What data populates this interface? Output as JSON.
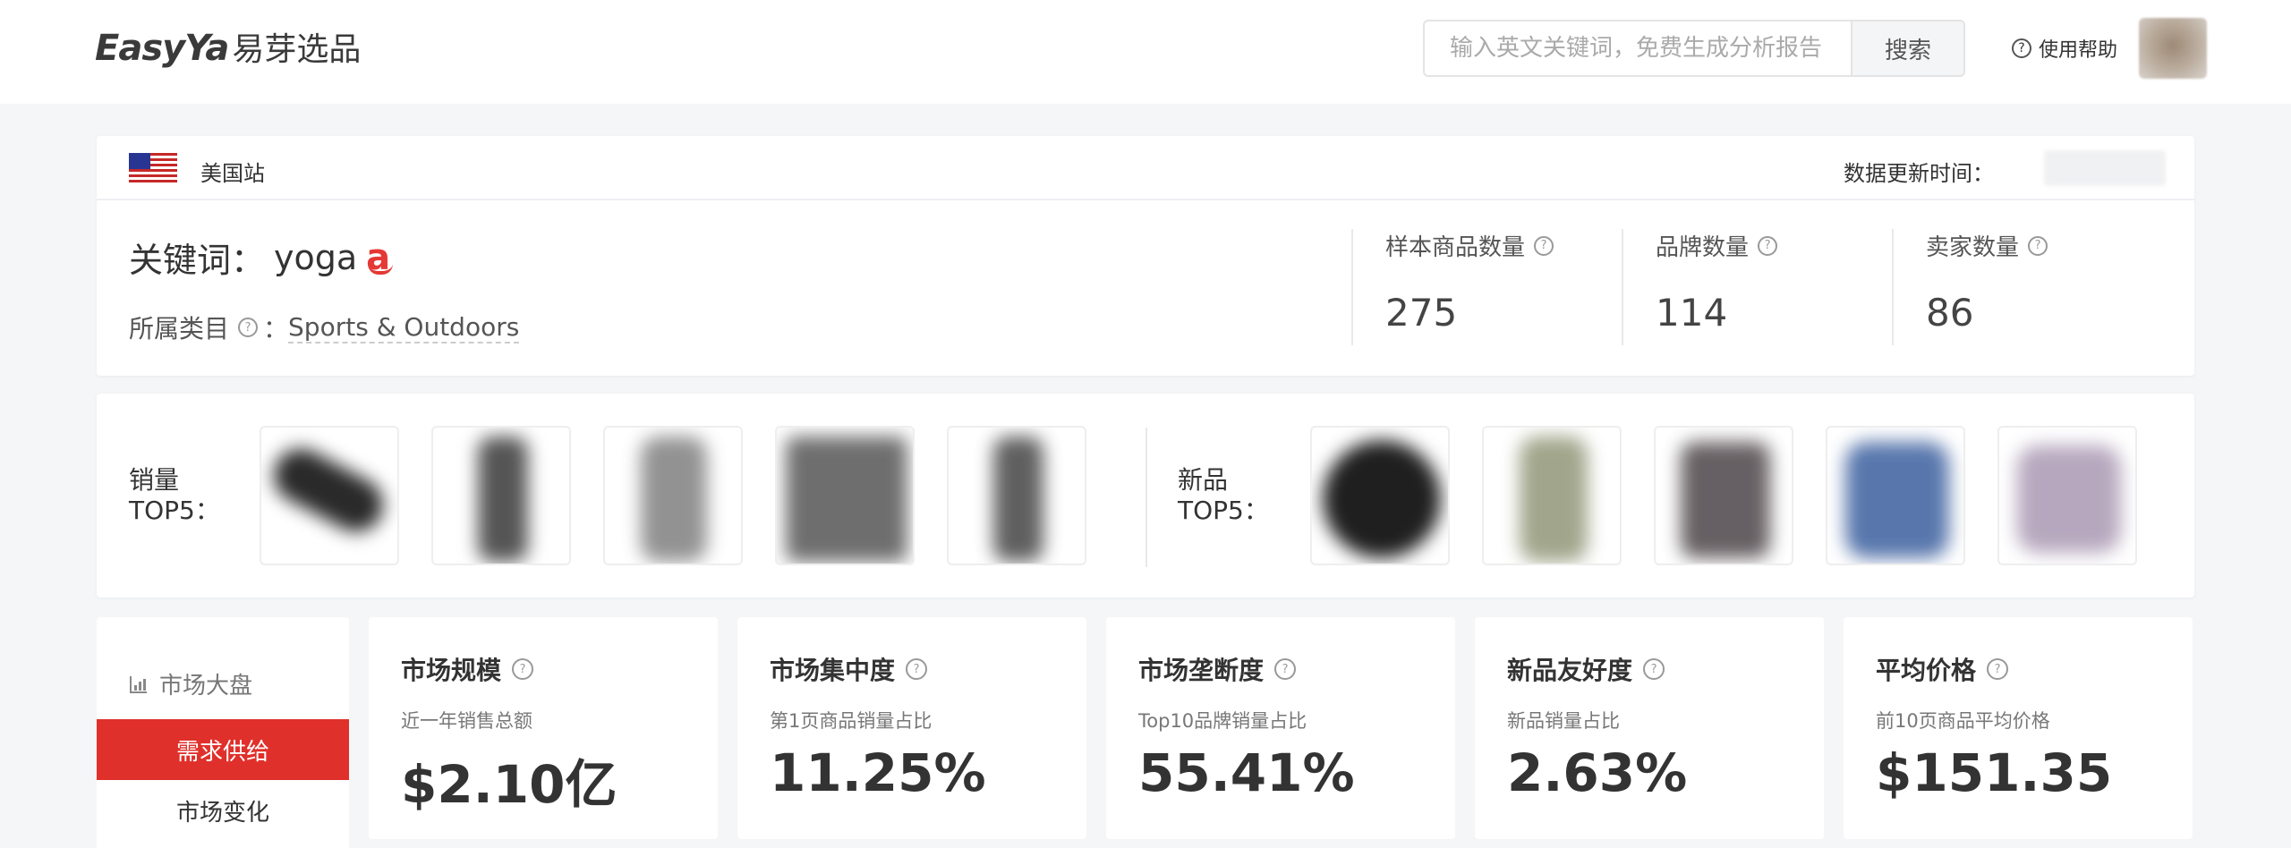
{
  "header": {
    "logo_en": "EasyYa",
    "logo_cn": "易芽选品",
    "search_placeholder": "输入英文关键词，免费生成分析报告",
    "search_button": "搜索",
    "help_label": "使用帮助",
    "help_icon": "question-circle-icon"
  },
  "site": {
    "name": "美国站",
    "update_label": "数据更新时间：",
    "flag_icon": "us-flag-icon"
  },
  "keyword": {
    "label": "关键词：",
    "value": "yoga",
    "marketplace_icon": "amazon-icon",
    "marketplace_glyph": "a",
    "category_label": "所属类目",
    "category_sep": "：",
    "category_value": "Sports & Outdoors"
  },
  "stats": [
    {
      "label": "样本商品数量",
      "value": "275"
    },
    {
      "label": "品牌数量",
      "value": "114"
    },
    {
      "label": "卖家数量",
      "value": "86"
    }
  ],
  "top5": {
    "sales_label_1": "销量",
    "sales_label_2": "TOP5：",
    "new_label_1": "新品",
    "new_label_2": "TOP5："
  },
  "sidebar": {
    "title": "市场大盘",
    "title_icon": "bar-chart-icon",
    "items": [
      {
        "label": "需求供给",
        "active": true
      },
      {
        "label": "市场变化",
        "active": false
      }
    ]
  },
  "metrics": [
    {
      "title": "市场规模",
      "subtitle": "近一年销售总额",
      "value": "$2.10亿"
    },
    {
      "title": "市场集中度",
      "subtitle": "第1页商品销量占比",
      "value": "11.25%"
    },
    {
      "title": "市场垄断度",
      "subtitle": "Top10品牌销量占比",
      "value": "55.41%"
    },
    {
      "title": "新品友好度",
      "subtitle": "新品销量占比",
      "value": "2.63%"
    },
    {
      "title": "平均价格",
      "subtitle": "前10页商品平均价格",
      "value": "$151.35"
    }
  ],
  "colors": {
    "accent": "#e0302b",
    "background": "#f5f6f8"
  }
}
